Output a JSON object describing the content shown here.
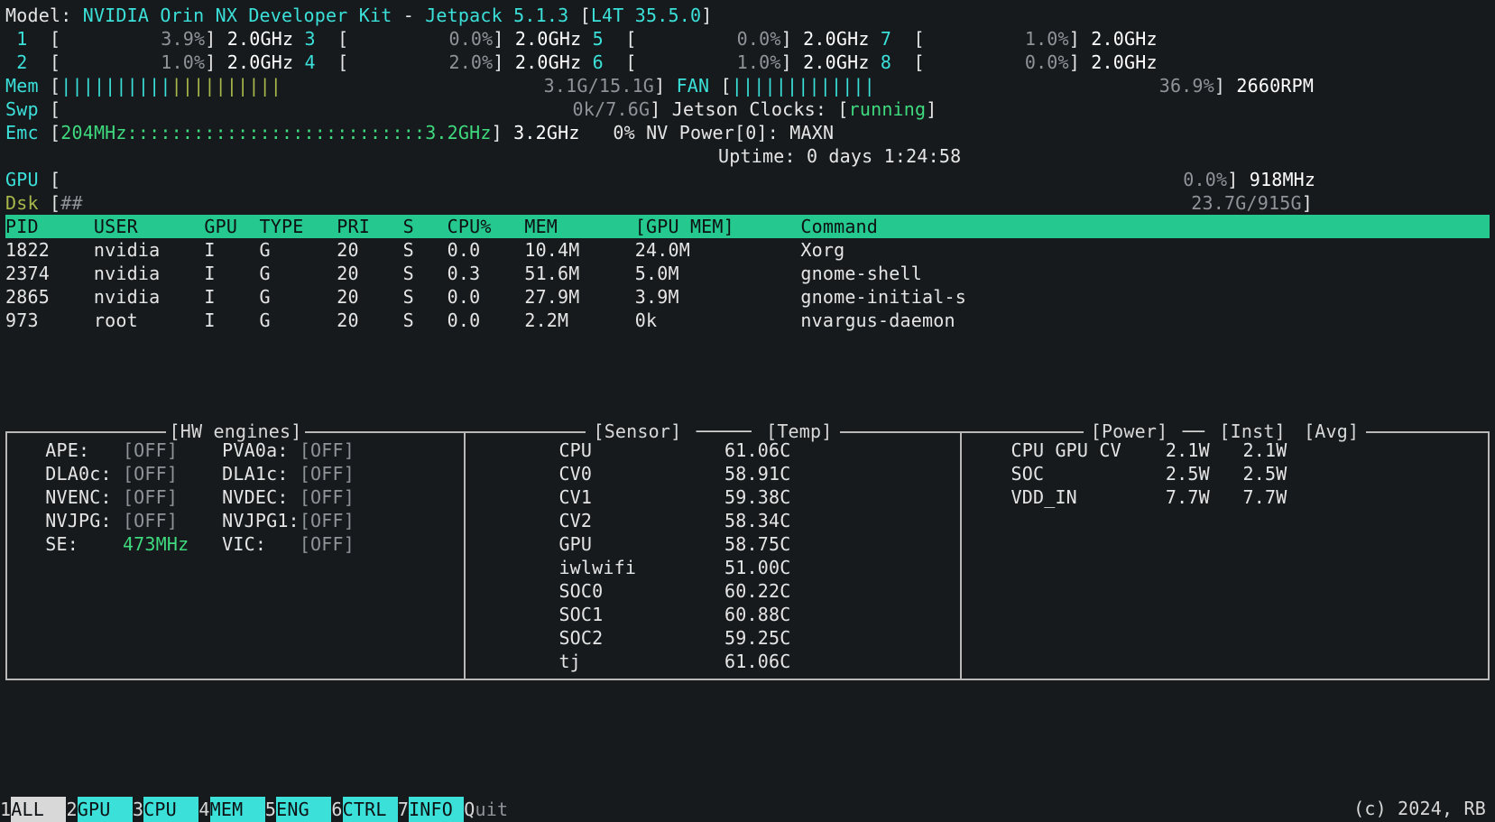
{
  "model": {
    "label": "Model:",
    "name": "NVIDIA Orin NX Developer Kit",
    "jetpack": "Jetpack 5.1.3",
    "l4t": "L4T 35.5.0"
  },
  "cpus": [
    {
      "n": "1",
      "pct": "3.9%",
      "freq": "2.0GHz"
    },
    {
      "n": "2",
      "pct": "1.0%",
      "freq": "2.0GHz"
    },
    {
      "n": "3",
      "pct": "0.0%",
      "freq": "2.0GHz"
    },
    {
      "n": "4",
      "pct": "2.0%",
      "freq": "2.0GHz"
    },
    {
      "n": "5",
      "pct": "0.0%",
      "freq": "2.0GHz"
    },
    {
      "n": "6",
      "pct": "1.0%",
      "freq": "2.0GHz"
    },
    {
      "n": "7",
      "pct": "1.0%",
      "freq": "2.0GHz"
    },
    {
      "n": "8",
      "pct": "0.0%",
      "freq": "2.0GHz"
    }
  ],
  "mem": {
    "label": "Mem",
    "bar": "||||||||||||||||||||",
    "value": "3.1G/15.1G"
  },
  "swp": {
    "label": "Swp",
    "value": "0k/7.6G"
  },
  "emc": {
    "label": "Emc",
    "low": "204MHz",
    "high": "3.2GHz",
    "freq": "3.2GHz",
    "util": "0%"
  },
  "fan": {
    "label": "FAN",
    "bar": "|||||||||||||",
    "pct": "36.9%",
    "rpm": "2660RPM"
  },
  "jetson_clocks": {
    "label": "Jetson Clocks:",
    "state": "running"
  },
  "nv_power": {
    "label": "NV Power[0]:",
    "mode": "MAXN"
  },
  "uptime": {
    "label": "Uptime:",
    "value": "0 days 1:24:58"
  },
  "gpu": {
    "label": "GPU",
    "pct": "0.0%",
    "freq": "918MHz"
  },
  "dsk": {
    "label": "Dsk",
    "bar": "##",
    "value": "23.7G/915G"
  },
  "proc_header": [
    "PID",
    "USER",
    "GPU",
    "TYPE",
    "PRI",
    "S",
    "CPU%",
    "MEM",
    "[GPU MEM]",
    "Command"
  ],
  "procs": [
    {
      "pid": "1822",
      "user": "nvidia",
      "gpu": "I",
      "type": "G",
      "pri": "20",
      "s": "S",
      "cpu": "0.0",
      "mem": "10.4M",
      "gmem": "24.0M",
      "cmd": "Xorg"
    },
    {
      "pid": "2374",
      "user": "nvidia",
      "gpu": "I",
      "type": "G",
      "pri": "20",
      "s": "S",
      "cpu": "0.3",
      "mem": "51.6M",
      "gmem": "5.0M",
      "cmd": "gnome-shell"
    },
    {
      "pid": "2865",
      "user": "nvidia",
      "gpu": "I",
      "type": "G",
      "pri": "20",
      "s": "S",
      "cpu": "0.0",
      "mem": "27.9M",
      "gmem": "3.9M",
      "cmd": "gnome-initial-s"
    },
    {
      "pid": "973",
      "user": "root",
      "gpu": "I",
      "type": "G",
      "pri": "20",
      "s": "S",
      "cpu": "0.0",
      "mem": "2.2M",
      "gmem": "0k",
      "cmd": "nvargus-daemon"
    }
  ],
  "hw_engines": {
    "title": "[HW engines]",
    "rows": [
      [
        {
          "k": "APE:",
          "v": "[OFF]"
        },
        {
          "k": "PVA0a:",
          "v": "[OFF]"
        }
      ],
      [
        {
          "k": "DLA0c:",
          "v": "[OFF]"
        },
        {
          "k": "DLA1c:",
          "v": "[OFF]"
        }
      ],
      [
        {
          "k": "NVENC:",
          "v": "[OFF]"
        },
        {
          "k": "NVDEC:",
          "v": "[OFF]"
        }
      ],
      [
        {
          "k": "NVJPG:",
          "v": "[OFF]"
        },
        {
          "k": "NVJPG1:",
          "v": "[OFF]"
        }
      ],
      [
        {
          "k": "SE:",
          "v": "473MHz",
          "green": true
        },
        {
          "k": "VIC:",
          "v": "[OFF]"
        }
      ]
    ]
  },
  "sensors": {
    "title_left": "[Sensor]",
    "title_right": "[Temp]",
    "rows": [
      {
        "name": "CPU",
        "temp": "61.06C"
      },
      {
        "name": "CV0",
        "temp": "58.91C"
      },
      {
        "name": "CV1",
        "temp": "59.38C"
      },
      {
        "name": "CV2",
        "temp": "58.34C"
      },
      {
        "name": "GPU",
        "temp": "58.75C"
      },
      {
        "name": "iwlwifi",
        "temp": "51.00C"
      },
      {
        "name": "SOC0",
        "temp": "60.22C"
      },
      {
        "name": "SOC1",
        "temp": "60.88C"
      },
      {
        "name": "SOC2",
        "temp": "59.25C"
      },
      {
        "name": "tj",
        "temp": "61.06C"
      }
    ]
  },
  "power": {
    "titles": [
      "[Power]",
      "[Inst]",
      "[Avg]"
    ],
    "rows": [
      {
        "name": "CPU GPU CV",
        "inst": "2.1W",
        "avg": "2.1W"
      },
      {
        "name": "SOC",
        "inst": "2.5W",
        "avg": "2.5W"
      },
      {
        "name": "VDD_IN",
        "inst": "7.7W",
        "avg": "7.7W"
      }
    ]
  },
  "menu": {
    "items": [
      {
        "key": "1",
        "label": "ALL",
        "selected": true
      },
      {
        "key": "2",
        "label": "GPU"
      },
      {
        "key": "3",
        "label": "CPU"
      },
      {
        "key": "4",
        "label": "MEM"
      },
      {
        "key": "5",
        "label": "ENG"
      },
      {
        "key": "6",
        "label": "CTRL"
      },
      {
        "key": "7",
        "label": "INFO"
      }
    ],
    "quit_key": "Q",
    "quit_label": "uit"
  },
  "credit": "(c) 2024, RB"
}
